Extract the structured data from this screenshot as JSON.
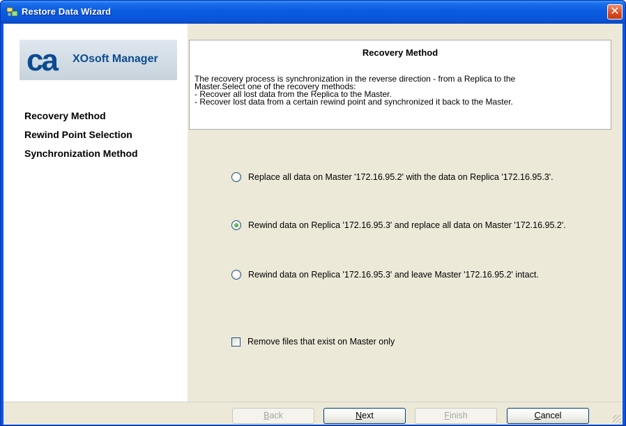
{
  "window": {
    "title": "Restore Data Wizard",
    "close_label": "✕"
  },
  "logo": {
    "brand": "ca",
    "product": "XOsoft Manager"
  },
  "nav": {
    "items": [
      {
        "label": "Recovery Method"
      },
      {
        "label": "Rewind Point Selection"
      },
      {
        "label": "Synchronization Method"
      }
    ]
  },
  "header": {
    "title": "Recovery Method",
    "description": [
      "The recovery process is synchronization in the reverse direction - from a Replica to the",
      "Master.Select one of the recovery methods:",
      "- Recover all lost data from the Replica to the Master.",
      "- Recover lost data from a certain rewind point and synchronized it back to the Master."
    ]
  },
  "options": {
    "radios": [
      {
        "label": "Replace all data on Master '172.16.95.2' with the data on Replica '172.16.95.3'.",
        "checked": false
      },
      {
        "label": "Rewind data on Replica '172.16.95.3' and replace all data on Master '172.16.95.2'.",
        "checked": true
      },
      {
        "label": "Rewind data on Replica '172.16.95.3' and leave Master '172.16.95.2' intact.",
        "checked": false
      }
    ],
    "checkbox": {
      "label": "Remove files that exist on Master only",
      "checked": false
    }
  },
  "buttons": {
    "back": {
      "access_key": "B",
      "rest": "ack",
      "enabled": false
    },
    "next": {
      "access_key": "N",
      "rest": "ext",
      "enabled": true
    },
    "finish": {
      "access_key": "F",
      "rest": "inish",
      "enabled": false
    },
    "cancel": {
      "access_key": "C",
      "rest": "ancel",
      "enabled": true
    }
  },
  "colors": {
    "titlebar": "#0a5be0",
    "accent": "#0b4b8f",
    "panel": "#ece9d8"
  }
}
